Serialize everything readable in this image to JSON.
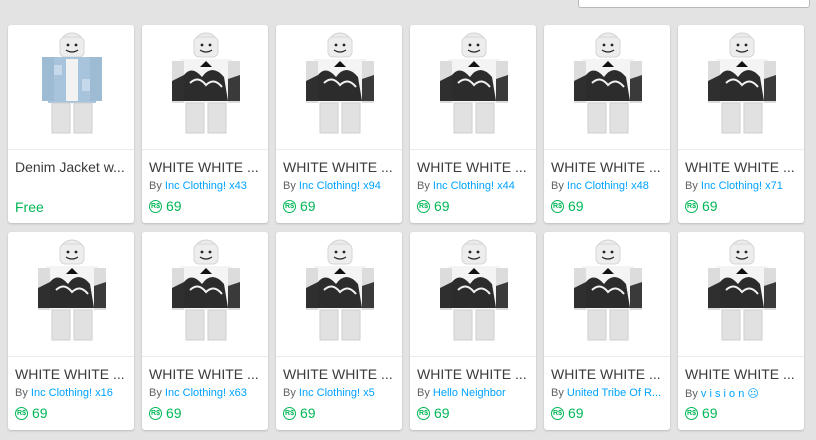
{
  "colors": {
    "price_green": "#02b757",
    "link_blue": "#00a2ff",
    "background": "#e3e3e3"
  },
  "items": [
    {
      "name": "Denim Jacket w...",
      "by": "",
      "creator": "",
      "price": "Free",
      "free": true,
      "thumb": "denim"
    },
    {
      "name": "WHITE WHITE ...",
      "by": "By",
      "creator": "Inc Clothing! x43",
      "price": "69",
      "free": false,
      "thumb": "white"
    },
    {
      "name": "WHITE WHITE ...",
      "by": "By",
      "creator": "Inc Clothing! x94",
      "price": "69",
      "free": false,
      "thumb": "white"
    },
    {
      "name": "WHITE WHITE ...",
      "by": "By",
      "creator": "Inc Clothing! x44",
      "price": "69",
      "free": false,
      "thumb": "white"
    },
    {
      "name": "WHITE WHITE ...",
      "by": "By",
      "creator": "Inc Clothing! x48",
      "price": "69",
      "free": false,
      "thumb": "white"
    },
    {
      "name": "WHITE WHITE ...",
      "by": "By",
      "creator": "Inc Clothing! x71",
      "price": "69",
      "free": false,
      "thumb": "white"
    },
    {
      "name": "WHITE WHITE ...",
      "by": "By",
      "creator": "Inc Clothing! x16",
      "price": "69",
      "free": false,
      "thumb": "white"
    },
    {
      "name": "WHITE WHITE ...",
      "by": "By",
      "creator": "Inc Clothing! x63",
      "price": "69",
      "free": false,
      "thumb": "white"
    },
    {
      "name": "WHITE WHITE ...",
      "by": "By",
      "creator": "Inc Clothing! x5",
      "price": "69",
      "free": false,
      "thumb": "white"
    },
    {
      "name": "WHITE WHITE ...",
      "by": "By",
      "creator": "Hello Neighbor",
      "price": "69",
      "free": false,
      "thumb": "white"
    },
    {
      "name": "WHITE WHITE ...",
      "by": "By",
      "creator": "United Tribe Of R...",
      "price": "69",
      "free": false,
      "thumb": "white"
    },
    {
      "name": "WHITE WHITE ...",
      "by": "By",
      "creator": "v i s i o n ☹",
      "price": "69",
      "free": false,
      "thumb": "white"
    }
  ],
  "icons": {
    "price": "robux-icon",
    "robux_glyph": "R$"
  }
}
